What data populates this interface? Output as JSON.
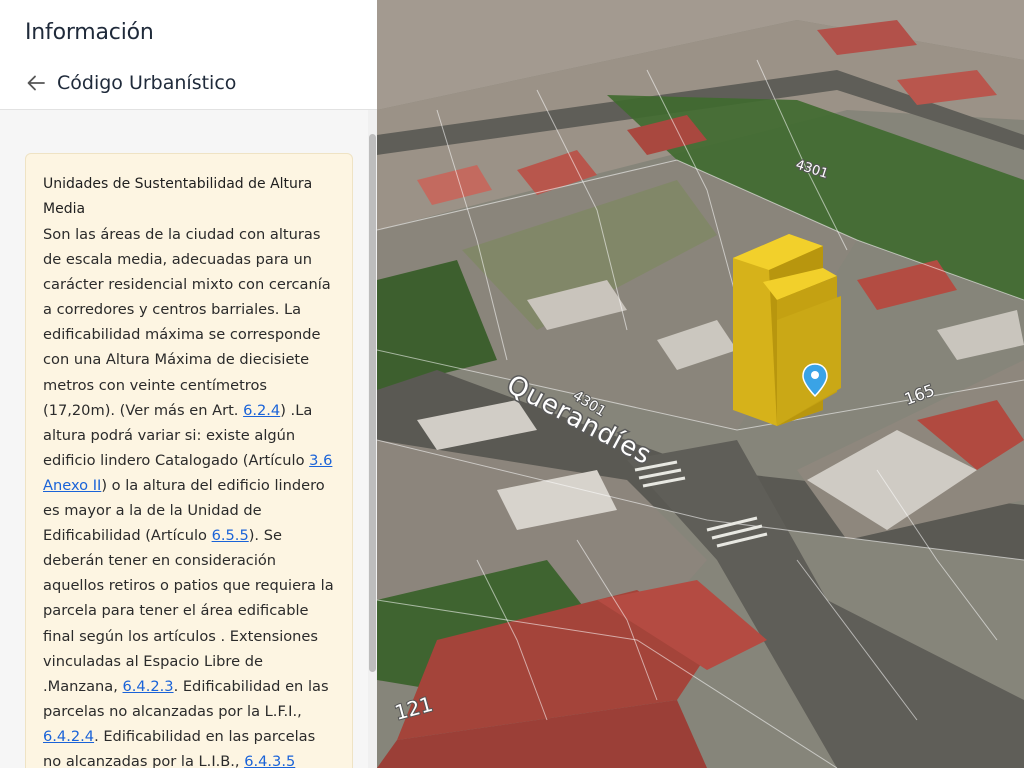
{
  "panel": {
    "title": "Información",
    "back_label": "Código Urbanístico"
  },
  "info": {
    "title": "Unidades de Sustentabilidad de Altura Media",
    "text_1": "Son las áreas de la ciudad con alturas de escala media, adecuadas para un carácter residencial mixto con cercanía a corredores y centros barriales. La edificabilidad máxima se corresponde con una Altura Máxima de diecisiete metros con veinte centímetros (17,20m). (Ver más en Art. ",
    "link_1": "6.2.4",
    "text_2": ") .La altura podrá variar si: existe algún edificio lindero Catalogado (Artículo ",
    "link_2": "3.6 Anexo II",
    "text_3": ") o la altura del edificio lindero es mayor a la de la Unidad de Edificabilidad (Artículo ",
    "link_3": "6.5.5",
    "text_4": "). Se deberán tener en consideración aquellos retiros o patios que requiera la parcela para tener el área edificable final según los artículos . Extensiones vinculadas al Espacio Libre de .Manzana, ",
    "link_4": "6.4.2.3",
    "text_5": ". Edificabilidad en las parcelas no alcanzadas por la L.F.I., ",
    "link_5": "6.4.2.4",
    "text_6": ". Edificabilidad en las parcelas no alcanzadas por la L.I.B., ",
    "link_6": "6.4.3.5"
  },
  "map": {
    "street_name": "Querandíes",
    "number_label_1": "4301",
    "number_label_2": "4301",
    "number_label_3": "4301",
    "lot_label_1": "165",
    "lot_label_2": "121"
  },
  "colors": {
    "accent": "#1a63d8",
    "card_bg": "#fdf5e2",
    "building": "#e9c21c",
    "marker": "#3aa3e6"
  }
}
